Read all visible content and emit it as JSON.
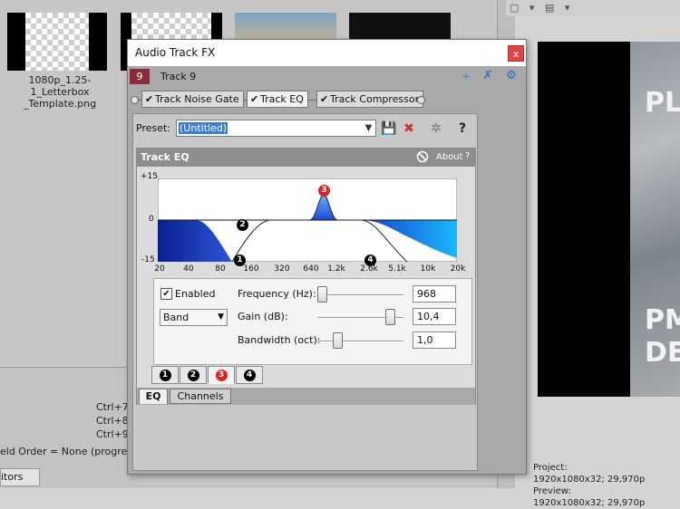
{
  "media": {
    "thumbnail_caption_line1": "1080p_1.25-1_Letterbox",
    "thumbnail_caption_line2": "_Template.png"
  },
  "shortcuts": [
    "Ctrl+7",
    "Ctrl+8",
    "Ctrl+9"
  ],
  "field_order": "eld Order = None (progressive",
  "bottom_tab": "itors",
  "preview": {
    "text_lines": [
      "PL",
      "PM",
      "DE"
    ],
    "project_label": "Project:",
    "project_value": "1920x1080x32; 29,970p",
    "preview_label": "Preview:",
    "preview_value": "1920x1080x32; 29,970p"
  },
  "dialog": {
    "title": "Audio Track FX",
    "close_label": "x",
    "track_number": "9",
    "track_name": "Track 9",
    "plugins": [
      {
        "label": "Track Noise Gate",
        "checked": true
      },
      {
        "label": "Track EQ",
        "checked": true
      },
      {
        "label": "Track Compressor",
        "checked": true
      }
    ],
    "preset_label": "Preset:",
    "preset_value": "(Untitled)"
  },
  "eq": {
    "title": "Track EQ",
    "about_label": "About",
    "help_label": "?",
    "y_labels": [
      "+15",
      "0",
      "-15"
    ],
    "x_labels": [
      "20",
      "40",
      "80",
      "160",
      "320",
      "640",
      "1.2k",
      "2.6k",
      "5.1k",
      "10k",
      "20k"
    ],
    "band_markers": [
      "1",
      "2",
      "3",
      "4"
    ],
    "enabled_label": "Enabled",
    "enabled_checked": true,
    "filter_type": "Band",
    "frequency_label": "Frequency (Hz):",
    "frequency_value": "968",
    "gain_label": "Gain (dB):",
    "gain_value": "10,4",
    "bandwidth_label": "Bandwidth (oct):",
    "bandwidth_value": "1,0",
    "band_tabs": [
      "1",
      "2",
      "3",
      "4"
    ],
    "active_band": "3",
    "tab_eq": "EQ",
    "tab_channels": "Channels"
  },
  "colors": {
    "accent_blue": "#3a7bd5",
    "track_badge": "#8c2b3a",
    "close_red": "#e04343",
    "active_band_marker": "#dd2222"
  }
}
